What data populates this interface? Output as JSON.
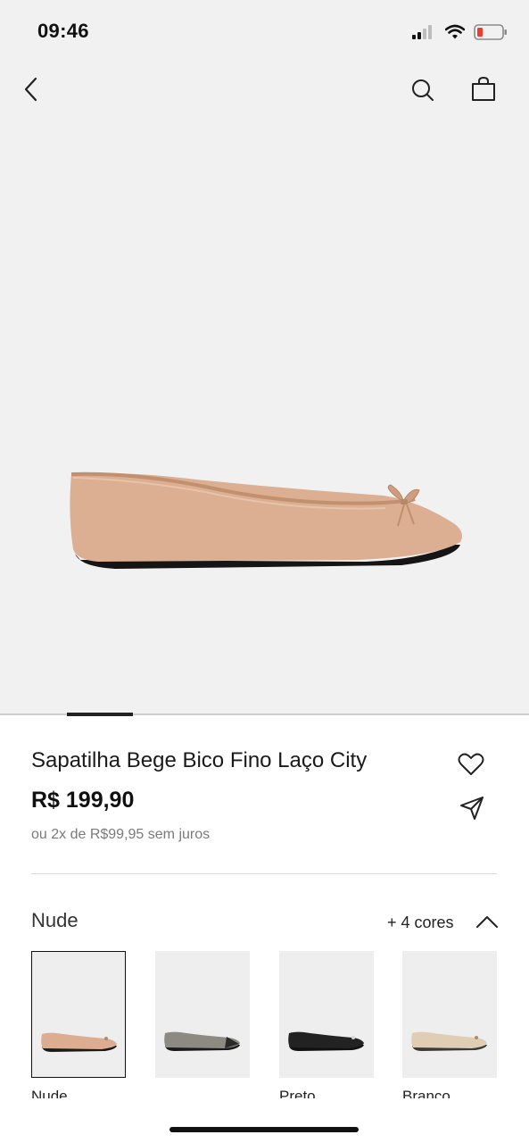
{
  "status_bar": {
    "time": "09:46"
  },
  "navigation": {
    "back_icon": "chevron-left-icon",
    "search_icon": "search-icon",
    "bag_icon": "shopping-bag-icon"
  },
  "product": {
    "title": "Sapatilha Bege Bico Fino Laço City",
    "price": "R$ 199,90",
    "installments": "ou 2x de R$99,95 sem juros",
    "image_color": "#dcae92"
  },
  "gallery": {
    "current_index": 1
  },
  "colors": {
    "selected_label": "Nude",
    "more_label": "+ 4 cores",
    "options": [
      {
        "name": "Nude",
        "shoe_color": "#dcad90",
        "selected": true
      },
      {
        "name": "",
        "shoe_color": "#8d8a82",
        "selected": false
      },
      {
        "name": "Preto",
        "shoe_color": "#222222",
        "selected": false
      },
      {
        "name": "Branco",
        "shoe_color": "#e0cdb6",
        "selected": false
      }
    ]
  }
}
